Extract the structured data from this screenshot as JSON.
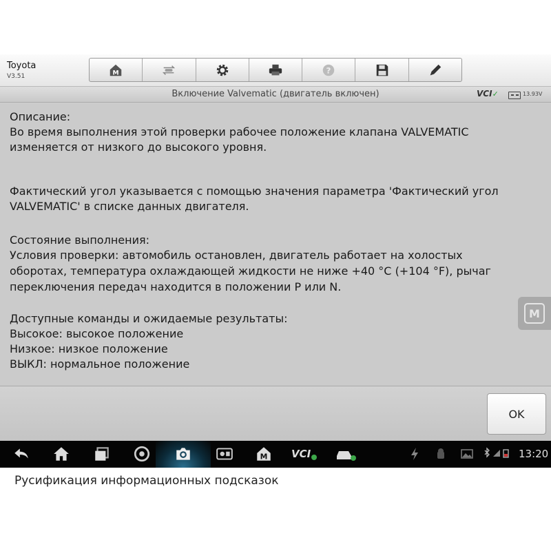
{
  "header": {
    "vehicle": "Toyota",
    "version": "V3.51",
    "toolbar": [
      {
        "name": "home-button",
        "icon": "home-m-icon"
      },
      {
        "name": "vehicle-swap-button",
        "icon": "car-swap-icon"
      },
      {
        "name": "settings-button",
        "icon": "gear-icon"
      },
      {
        "name": "print-button",
        "icon": "printer-icon"
      },
      {
        "name": "help-button",
        "icon": "help-icon"
      },
      {
        "name": "save-button",
        "icon": "floppy-icon"
      },
      {
        "name": "edit-button",
        "icon": "pencil-icon"
      }
    ]
  },
  "titlebar": {
    "title": "Включение Valvematic (двигатель включен)",
    "vci": "VCI",
    "battery_voltage": "13.93V"
  },
  "content": {
    "lines": [
      "Описание:",
      "Во время выполнения этой проверки рабочее положение клапана VALVEMATIC",
      "изменяется от низкого до высокого уровня.",
      "Фактический угол указывается с помощью значения параметра 'Фактический угол",
      "VALVEMATIC' в списке данных двигателя.",
      "Состояние выполнения:",
      "Условия проверки: автомобиль остановлен, двигатель работает на холостых",
      "оборотах, температура охлаждающей жидкости не ниже +40 °C (+104 °F), рычаг",
      "переключения передач находится в положении P или N.",
      "Доступные команды и ожидаемые результаты:",
      "Высокое: высокое положение",
      "Низкое: низкое положение",
      "ВЫКЛ: нормальное положение"
    ]
  },
  "float_button": {
    "label": "M"
  },
  "footer": {
    "ok_label": "OK"
  },
  "navbar": {
    "time": "13:20"
  },
  "caption": "Русификация информационных подсказок",
  "colors": {
    "background": "#cbcbcb",
    "navbar": "#050505",
    "vci_ok": "#2e9d3a"
  }
}
